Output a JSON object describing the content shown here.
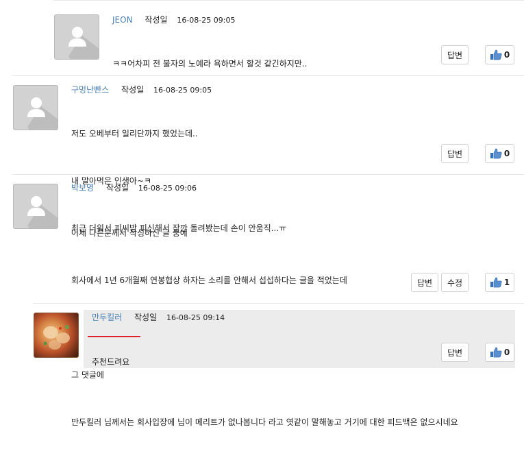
{
  "comments": [
    {
      "author": "JEON",
      "date_label": "작성일",
      "date": "16-08-25 09:05",
      "lines": [
        "ㅋㅋ어차피 전 불자의 노예라 욕하면서 할것 같긴하지만.."
      ],
      "reply_label": "답변",
      "likes": "0"
    },
    {
      "author": "구멍난빤스",
      "date_label": "작성일",
      "date": "16-08-25 09:05",
      "lines": [
        "저도 오베부터 일리단까지 했었는데..",
        "내 말아먹은 인생아~ㅋ",
        "최근 더워서 피씨방 피신해서 잠깐 돌려봤는데 손이 안움직...ㅠ"
      ],
      "reply_label": "답변",
      "likes": "0"
    },
    {
      "author": "박보영",
      "date_label": "작성일",
      "date": "16-08-25 09:06",
      "lines": [
        "어제 다른분께서 작성하신 글 중에",
        "회사에서 1년 6개월째 연봉협상 하자는 소리를 안해서 섭섭하다는 글을 적었는데",
        "",
        "그 댓글에",
        "만두킬러 님께서는 회사입장에 님이 메리트가 없나봅니다 라고 엿같이 말해놓고 거기에 대한 피드백은 없으시네요"
      ],
      "reply_label": "답변",
      "edit_label": "수정",
      "likes": "1"
    },
    {
      "author": "만두킬러",
      "date_label": "작성일",
      "date": "16-08-25 09:14",
      "lines": [
        "추천드려요"
      ],
      "reply_label": "답변",
      "likes": "0"
    }
  ],
  "icons": {
    "avatar": "default-user-avatar-icon",
    "like": "thumbs-up-icon"
  },
  "colors": {
    "author": "#4a7fb5",
    "highlight_underline": "#e0202a",
    "reply_background": "#ececec"
  }
}
